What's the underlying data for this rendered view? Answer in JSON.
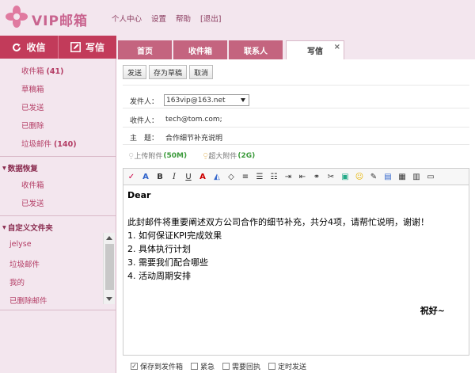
{
  "header": {
    "logo_text": "VIP邮箱",
    "nav": [
      "个人中心",
      "设置",
      "帮助",
      "[退出]"
    ]
  },
  "sidebar": {
    "receive_btn": "收信",
    "compose_btn": "写信",
    "folders": [
      {
        "label": "收件箱",
        "count": "(41)"
      },
      {
        "label": "草稿箱",
        "count": ""
      },
      {
        "label": "已发送",
        "count": ""
      },
      {
        "label": "已删除",
        "count": ""
      },
      {
        "label": "垃圾邮件",
        "count": "(140)"
      }
    ],
    "recovery": {
      "title": "数据恢复",
      "items": [
        "收件箱",
        "已发送"
      ]
    },
    "custom": {
      "title": "自定义文件夹",
      "items": [
        "jelyse",
        "垃圾邮件",
        "我的",
        "已删除邮件"
      ]
    }
  },
  "tabs": [
    "首页",
    "收件箱",
    "联系人",
    "写信"
  ],
  "tab_close": "×",
  "compose": {
    "buttons": [
      "发送",
      "存为草稿",
      "取消"
    ],
    "from_label": "发件人：",
    "from_value": "163vip@163.net",
    "to_label": "收件人：",
    "to_value": "tech@tom.com;",
    "subject_label": "主　题：",
    "subject_value": "合作细节补充说明",
    "attach_label": "上传附件",
    "attach_size": "(50M)",
    "big_attach_label": "超大附件",
    "big_attach_size": "(2G)",
    "body": {
      "greeting": "Dear",
      "intro": "此封邮件将重要阐述双方公司合作的细节补充，共分4项，请帮忙说明，谢谢！",
      "items": [
        "1. 如何保证KPI完成效果",
        "2. 具体执行计划",
        "3. 需要我们配合哪些",
        "4. 活动周期安排"
      ],
      "closing": "祝好~"
    },
    "options": [
      {
        "label": "保存到发件箱",
        "checked": true
      },
      {
        "label": "紧急",
        "checked": false
      },
      {
        "label": "需要回执",
        "checked": false
      },
      {
        "label": "定时发送",
        "checked": false
      }
    ]
  },
  "colors": {
    "accent": "#c23b5a",
    "tab": "#c4647f",
    "link": "#b33c64",
    "bg": "#f3e6ee"
  }
}
